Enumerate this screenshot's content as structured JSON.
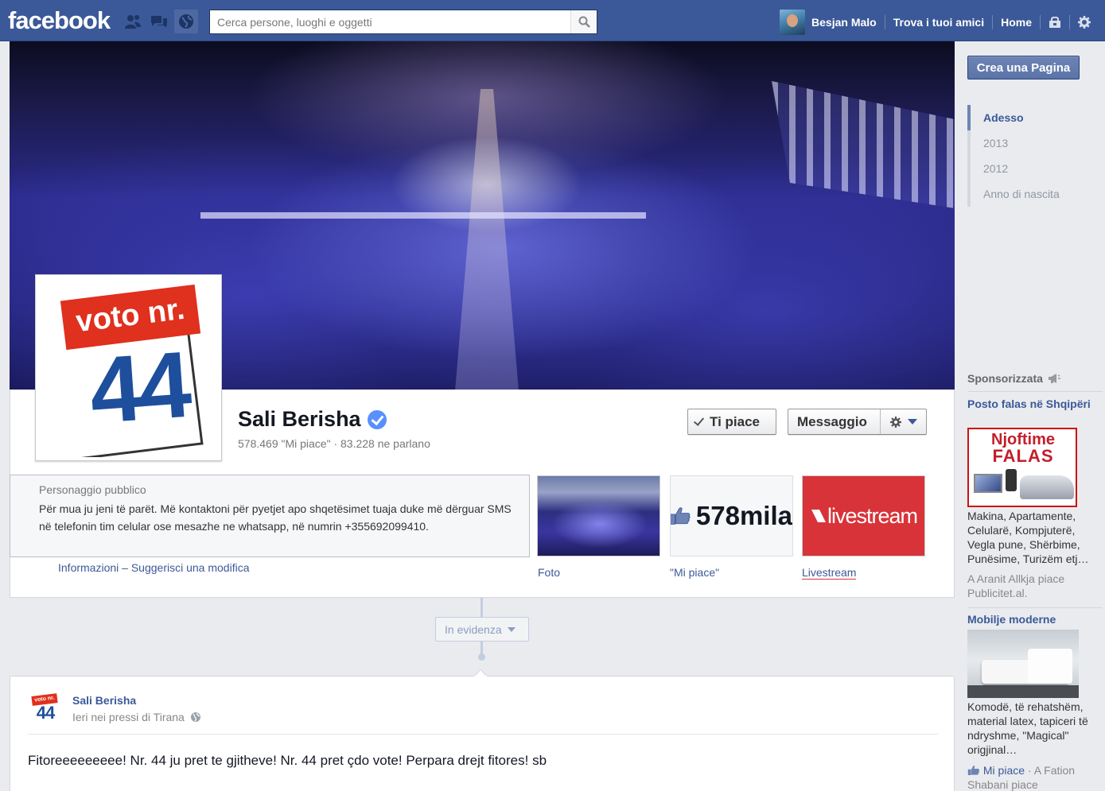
{
  "topbar": {
    "logo": "facebook",
    "search_placeholder": "Cerca persone, luoghi e oggetti",
    "user_name": "Besjan Malo",
    "find_friends": "Trova i tuoi amici",
    "home": "Home"
  },
  "cover": {
    "profile_pic_top": "voto nr.",
    "profile_pic_number": "44"
  },
  "page": {
    "name": "Sali Berisha",
    "stats": "578.469 \"Mi piace\" · 83.228 ne parlano",
    "like_button": "Ti piace",
    "message_button": "Messaggio",
    "category": "Personaggio pubblico",
    "about": "Për mua ju jeni të parët. Më kontaktoni për pyetjet apo shqetësimet tuaja duke më dërguar SMS në telefonin tim celular ose mesazhe ne whatsapp, në numrin +355692099410.",
    "info_link": "Informazioni",
    "link_separator": "–",
    "suggest_link": "Suggerisci una modifica"
  },
  "apps": [
    {
      "label": "Foto"
    },
    {
      "label": "\"Mi piace\"",
      "tile_text": "578mila"
    },
    {
      "label": "Livestream",
      "tile_text": "livestream"
    }
  ],
  "timeline": {
    "highlight_label": "In evidenza"
  },
  "post": {
    "author": "Sali Berisha",
    "meta": "Ieri nei pressi di Tirana",
    "avatar_top": "voto nr.",
    "avatar_number": "44",
    "text": "Fitoreeeeeeeee! Nr. 44 ju pret te gjitheve! Nr. 44 pret çdo vote! Perpara drejt fitores! sb"
  },
  "right": {
    "create_page": "Crea una Pagina",
    "years": [
      "Adesso",
      "2013",
      "2012",
      "Anno di nascita"
    ],
    "sponsored": "Sponsorizzata",
    "ads": [
      {
        "title": "Posto falas në Shqipëri",
        "image_line1": "Njoftime",
        "image_line2": "FALAS",
        "body": "Makina, Apartamente, Celularë, Kompjuterë, Vegla pune, Shërbime, Punësime, Turizëm etj…",
        "social": "A Aranit Allkja piace Publicitet.al."
      },
      {
        "title": "Mobilje moderne",
        "body": "Komodë, të rehatshëm, material latex, tapiceri të ndryshme, \"Magical\" origjinal…",
        "like_label": "Mi piace",
        "social": "· A Fation Shabani piace"
      }
    ]
  },
  "colors": {
    "brand_blue": "#3b5998",
    "link_blue": "#3b5998",
    "verified_blue": "#5890ff",
    "ad_red": "#c41e2b",
    "livestream_red": "#d83339"
  },
  "icons": [
    "friend-requests-icon",
    "messages-icon",
    "notifications-globe-icon",
    "search-icon",
    "privacy-lock-icon",
    "settings-gear-icon",
    "verified-badge-icon",
    "checkmark-icon",
    "gear-icon",
    "caret-down-icon",
    "thumbs-up-icon",
    "globe-icon",
    "megaphone-icon"
  ]
}
